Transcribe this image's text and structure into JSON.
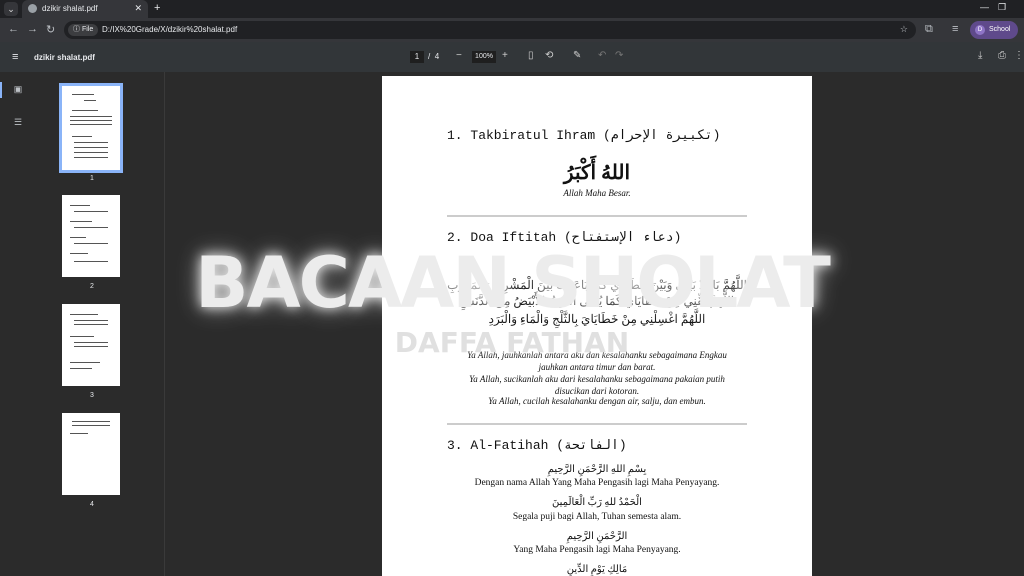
{
  "browser": {
    "tab_title": "dzikir shalat.pdf",
    "new_tab": "+",
    "address_chip": "File",
    "url": "D:/IX%20Grade/X/dzikir%20shalat.pdf",
    "profile_initial": "D",
    "profile_label": "School"
  },
  "pdf_toolbar": {
    "filename": "dzikir shalat.pdf",
    "current_page": "1",
    "separator": "/",
    "total_pages": "4",
    "zoom": "100%"
  },
  "thumbnails": [
    {
      "label": "1",
      "selected": true
    },
    {
      "label": "2",
      "selected": false
    },
    {
      "label": "3",
      "selected": false
    },
    {
      "label": "4",
      "selected": false
    }
  ],
  "document": {
    "s1_title": "1.  Takbiratul Ihram (تكبيرة الإحرام)",
    "s1_arabic": "اللهُ أَكْبَرُ",
    "s1_translation": "Allah Maha Besar.",
    "s2_title": "2.  Doa Iftitah (دعاء الإستفتاح)",
    "s2_arabic_1": "اللَّهُمَّ بَاعِدْ بَيْنِي وَبَيْنَ خَطَايَايَ كَمَا بَاعَدْتَ بَيْنَ الْمَشْرِقِ وَالْمَغْرِبِ",
    "s2_arabic_2": "اللَّهُمَّ نَقِّنِي مِنْ خَطَايَايَ كَمَا يُنَقَّى الثَّوْبُ الأَبْيَضُ مِنَ الدَّنَسِ",
    "s2_arabic_3": "اللَّهُمَّ اغْسِلْنِي مِنْ خَطَايَايَ بِالثَّلْجِ وَالْمَاءِ وَالْبَرَدِ",
    "s2_tr_1": "Ya Allah, jauhkanlah antara aku dan kesalahanku sebagaimana Engkau",
    "s2_tr_2": "jauhkan antara timur dan barat.",
    "s2_tr_3": "Ya Allah, sucikanlah aku dari kesalahanku sebagaimana pakaian putih",
    "s2_tr_4": "disucikan dari kotoran.",
    "s2_tr_5": "Ya Allah, cucilah kesalahanku dengan air, salju, dan embun.",
    "s3_title": "3.  Al-Fatihah (الفاتحة)",
    "s3_a1": "بِسْمِ اللهِ الرَّحْمَنِ الرَّحِيمِ",
    "s3_t1": "Dengan nama Allah Yang Maha Pengasih lagi Maha Penyayang.",
    "s3_a2": "الْحَمْدُ للهِ رَبِّ الْعَالَمِينَ",
    "s3_t2": "Segala puji bagi Allah, Tuhan semesta alam.",
    "s3_a3": "الرَّحْمَنِ الرَّحِيمِ",
    "s3_t3": "Yang Maha Pengasih lagi Maha Penyayang.",
    "s3_a4": "مَالِكِ يَوْمِ الدِّينِ"
  },
  "overlay": {
    "title": "BACAAN SHOLAT",
    "subtitle": "DAFFA FATHAN"
  }
}
